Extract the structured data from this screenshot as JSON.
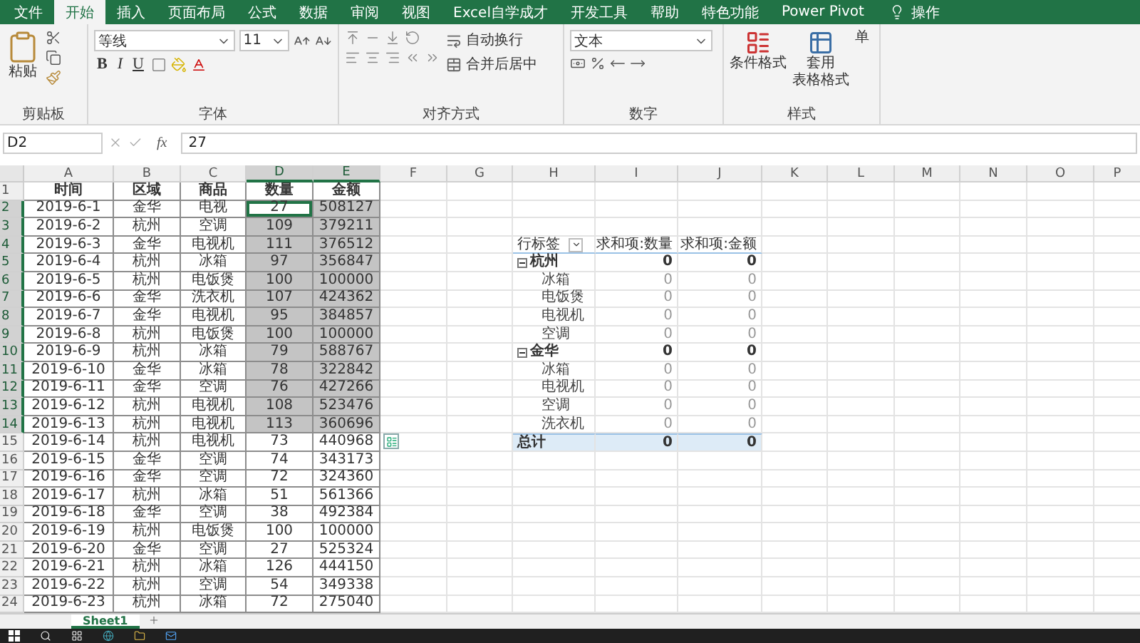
{
  "title_bar": {
    "tabs": [
      {
        "label": "文件",
        "selected": false
      },
      {
        "label": "开始",
        "selected": true
      },
      {
        "label": "插入",
        "selected": false
      },
      {
        "label": "页面布局",
        "selected": false
      },
      {
        "label": "公式",
        "selected": false
      },
      {
        "label": "数据",
        "selected": false
      },
      {
        "label": "审阅",
        "selected": false
      },
      {
        "label": "视图",
        "selected": false
      },
      {
        "label": "Excel自学成才",
        "selected": false
      },
      {
        "label": "开发工具",
        "selected": false
      },
      {
        "label": "帮助",
        "selected": false
      },
      {
        "label": "特色功能",
        "selected": false
      },
      {
        "label": "Power Pivot",
        "selected": false
      }
    ],
    "search_hint": "操作"
  },
  "ribbon": {
    "clipboard": {
      "paste": "粘贴",
      "label": "剪贴板"
    },
    "font": {
      "name": "等线",
      "size": "11",
      "buttons": [
        "B",
        "I",
        "U"
      ],
      "label": "字体"
    },
    "alignment": {
      "wrap": "自动换行",
      "merge": "合并后居中",
      "label": "对齐方式"
    },
    "number": {
      "format": "文本",
      "label": "数字"
    },
    "styles": {
      "conditional": "条件格式",
      "table_format": [
        "套用",
        "表格格式"
      ],
      "cell_styles": "单",
      "label": "样式"
    }
  },
  "formula_bar": {
    "name_box": "D2",
    "fx": "fx",
    "value": "27"
  },
  "columns": [
    {
      "label": "A",
      "selected": false
    },
    {
      "label": "B",
      "selected": false
    },
    {
      "label": "C",
      "selected": false
    },
    {
      "label": "D",
      "selected": true
    },
    {
      "label": "E",
      "selected": true
    },
    {
      "label": "F",
      "selected": false
    },
    {
      "label": "G",
      "selected": false
    },
    {
      "label": "H",
      "selected": false
    },
    {
      "label": "I",
      "selected": false
    },
    {
      "label": "J",
      "selected": false
    },
    {
      "label": "K",
      "selected": false
    },
    {
      "label": "L",
      "selected": false
    },
    {
      "label": "M",
      "selected": false
    },
    {
      "label": "N",
      "selected": false
    },
    {
      "label": "O",
      "selected": false
    },
    {
      "label": "P",
      "selected": false
    }
  ],
  "row_numbers": [
    {
      "label": "1",
      "selected": false
    },
    {
      "label": "2",
      "selected": true
    },
    {
      "label": "3",
      "selected": true
    },
    {
      "label": "4",
      "selected": true
    },
    {
      "label": "5",
      "selected": true
    },
    {
      "label": "6",
      "selected": true
    },
    {
      "label": "7",
      "selected": true
    },
    {
      "label": "8",
      "selected": true
    },
    {
      "label": "9",
      "selected": true
    },
    {
      "label": "10",
      "selected": true
    },
    {
      "label": "11",
      "selected": true
    },
    {
      "label": "12",
      "selected": true
    },
    {
      "label": "13",
      "selected": true
    },
    {
      "label": "14",
      "selected": true
    },
    {
      "label": "15",
      "selected": false
    },
    {
      "label": "16",
      "selected": false
    },
    {
      "label": "17",
      "selected": false
    },
    {
      "label": "18",
      "selected": false
    },
    {
      "label": "19",
      "selected": false
    },
    {
      "label": "20",
      "selected": false
    },
    {
      "label": "21",
      "selected": false
    },
    {
      "label": "22",
      "selected": false
    },
    {
      "label": "23",
      "selected": false
    },
    {
      "label": "24",
      "selected": false
    }
  ],
  "table": {
    "headers": [
      "时间",
      "区域",
      "商品",
      "数量",
      "金额"
    ],
    "rows": [
      {
        "cells": [
          "2019-6-1",
          "金华",
          "电视",
          "27",
          "508127"
        ],
        "selected": true,
        "active": true
      },
      {
        "cells": [
          "2019-6-2",
          "杭州",
          "空调",
          "109",
          "379211"
        ],
        "selected": true,
        "active": false
      },
      {
        "cells": [
          "2019-6-3",
          "金华",
          "电视机",
          "111",
          "376512"
        ],
        "selected": true,
        "active": false
      },
      {
        "cells": [
          "2019-6-4",
          "杭州",
          "冰箱",
          "97",
          "356847"
        ],
        "selected": true,
        "active": false
      },
      {
        "cells": [
          "2019-6-5",
          "杭州",
          "电饭煲",
          "100",
          "100000"
        ],
        "selected": true,
        "active": false
      },
      {
        "cells": [
          "2019-6-6",
          "金华",
          "洗衣机",
          "107",
          "424362"
        ],
        "selected": true,
        "active": false
      },
      {
        "cells": [
          "2019-6-7",
          "金华",
          "电视机",
          "95",
          "384857"
        ],
        "selected": true,
        "active": false
      },
      {
        "cells": [
          "2019-6-8",
          "杭州",
          "电饭煲",
          "100",
          "100000"
        ],
        "selected": true,
        "active": false
      },
      {
        "cells": [
          "2019-6-9",
          "杭州",
          "冰箱",
          "79",
          "588767"
        ],
        "selected": true,
        "active": false
      },
      {
        "cells": [
          "2019-6-10",
          "金华",
          "冰箱",
          "78",
          "322842"
        ],
        "selected": true,
        "active": false
      },
      {
        "cells": [
          "2019-6-11",
          "金华",
          "空调",
          "76",
          "427266"
        ],
        "selected": true,
        "active": false
      },
      {
        "cells": [
          "2019-6-12",
          "杭州",
          "电视机",
          "108",
          "523476"
        ],
        "selected": true,
        "active": false
      },
      {
        "cells": [
          "2019-6-13",
          "杭州",
          "电视机",
          "113",
          "360696"
        ],
        "selected": true,
        "active": false
      },
      {
        "cells": [
          "2019-6-14",
          "杭州",
          "电视机",
          "73",
          "440968"
        ],
        "selected": false,
        "active": false
      },
      {
        "cells": [
          "2019-6-15",
          "金华",
          "空调",
          "74",
          "343173"
        ],
        "selected": false,
        "active": false
      },
      {
        "cells": [
          "2019-6-16",
          "金华",
          "空调",
          "72",
          "324360"
        ],
        "selected": false,
        "active": false
      },
      {
        "cells": [
          "2019-6-17",
          "杭州",
          "冰箱",
          "51",
          "561366"
        ],
        "selected": false,
        "active": false
      },
      {
        "cells": [
          "2019-6-18",
          "金华",
          "空调",
          "38",
          "492384"
        ],
        "selected": false,
        "active": false
      },
      {
        "cells": [
          "2019-6-19",
          "杭州",
          "电饭煲",
          "100",
          "100000"
        ],
        "selected": false,
        "active": false
      },
      {
        "cells": [
          "2019-6-20",
          "金华",
          "空调",
          "27",
          "525324"
        ],
        "selected": false,
        "active": false
      },
      {
        "cells": [
          "2019-6-21",
          "杭州",
          "冰箱",
          "126",
          "444150"
        ],
        "selected": false,
        "active": false
      },
      {
        "cells": [
          "2019-6-22",
          "杭州",
          "空调",
          "54",
          "349338"
        ],
        "selected": false,
        "active": false
      },
      {
        "cells": [
          "2019-6-23",
          "杭州",
          "冰箱",
          "72",
          "275040"
        ],
        "selected": false,
        "active": false
      }
    ]
  },
  "pivot": {
    "header": [
      "行标签",
      "求和项:数量",
      "求和项:金额"
    ],
    "groups": [
      {
        "label": "杭州",
        "values": [
          "0",
          "0"
        ],
        "expanded": true,
        "children": [
          {
            "label": "冰箱",
            "values": [
              "0",
              "0"
            ]
          },
          {
            "label": "电饭煲",
            "values": [
              "0",
              "0"
            ]
          },
          {
            "label": "电视机",
            "values": [
              "0",
              "0"
            ]
          },
          {
            "label": "空调",
            "values": [
              "0",
              "0"
            ]
          }
        ]
      },
      {
        "label": "金华",
        "values": [
          "0",
          "0"
        ],
        "expanded": true,
        "children": [
          {
            "label": "冰箱",
            "values": [
              "0",
              "0"
            ]
          },
          {
            "label": "电视机",
            "values": [
              "0",
              "0"
            ]
          },
          {
            "label": "空调",
            "values": [
              "0",
              "0"
            ]
          },
          {
            "label": "洗衣机",
            "values": [
              "0",
              "0"
            ]
          }
        ]
      }
    ],
    "total": {
      "label": "总计",
      "values": [
        "0",
        "0"
      ]
    }
  },
  "sheet_tabs": [
    {
      "label": "Sheet1",
      "selected": true
    }
  ]
}
